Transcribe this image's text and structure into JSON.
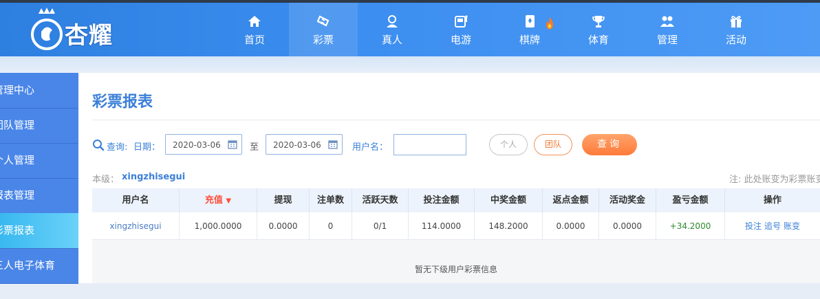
{
  "logo": {
    "text": "杏耀"
  },
  "nav": [
    {
      "label": "首页",
      "icon": "home-icon"
    },
    {
      "label": "彩票",
      "icon": "ticket-icon",
      "active": true
    },
    {
      "label": "真人",
      "icon": "dealer-icon"
    },
    {
      "label": "电游",
      "icon": "slot-machine-icon"
    },
    {
      "label": "棋牌",
      "icon": "poker-card-icon",
      "badge": "fire-icon"
    },
    {
      "label": "体育",
      "icon": "trophy-icon"
    },
    {
      "label": "管理",
      "icon": "users-icon"
    },
    {
      "label": "活动",
      "icon": "gift-icon"
    }
  ],
  "sidebar": {
    "items": [
      {
        "label": "管理中心"
      },
      {
        "label": "团队管理"
      },
      {
        "label": "个人管理"
      },
      {
        "label": "报表管理"
      },
      {
        "label": "彩票报表",
        "active": true
      },
      {
        "label": "三人电子体育"
      }
    ]
  },
  "page": {
    "title": "彩票报表"
  },
  "query": {
    "query_label": "查询:",
    "date_label": "日期：",
    "start_date": "2020-03-06",
    "to_label": "至",
    "end_date": "2020-03-06",
    "username_label": "用户名：",
    "username_value": "",
    "personal_label": "个人",
    "team_label": "团队",
    "search_label": "查询"
  },
  "level": {
    "label": "本级：",
    "name": "xingzhisegui",
    "note": "注: 此处账变为彩票账变"
  },
  "table": {
    "headers": [
      "用户名",
      "充值",
      "提现",
      "注单数",
      "活跃天数",
      "投注金额",
      "中奖金额",
      "返点金额",
      "活动奖金",
      "盈亏金额",
      "操作"
    ],
    "sort_column": "充值",
    "row": {
      "username": "xingzhisegui",
      "deposit": "1,000.0000",
      "withdraw": "0.0000",
      "bet_count": "0",
      "active_days": "0/1",
      "bet_amount": "114.0000",
      "win_amount": "148.2000",
      "rebate": "0.0000",
      "bonus": "0.0000",
      "profit": "+34.2000",
      "actions": [
        "投注",
        "追号",
        "账变"
      ]
    },
    "empty_text": "暂无下级用户彩票信息"
  },
  "colors": {
    "header_blue": "#3c8ef0",
    "sidebar_blue": "#4a86e8",
    "accent_blue": "#3a7fd8",
    "orange": "#ff7a3a",
    "profit_green": "#2a8a2a"
  }
}
